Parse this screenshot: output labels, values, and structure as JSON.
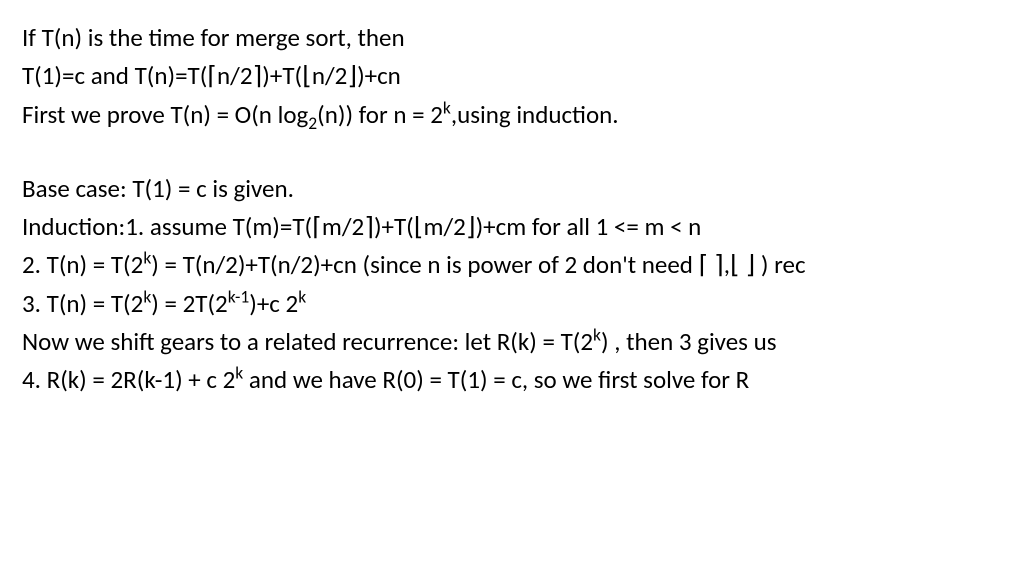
{
  "lines": {
    "l1": "If T(n) is the time for merge sort, then",
    "l2_pre": "T(1)=c and  T(n)=T(",
    "l2_ceil_open": "⌈",
    "l2_ceil_close": "⌉",
    "l2_mid1": "n/2",
    "l2_mid2": ")+T(",
    "l2_floor_open": "⌊",
    "l2_floor_close": "⌋",
    "l2_mid3": "n/2",
    "l2_end": ")+cn",
    "l3_pre": "First we prove T(n) = O(n log",
    "l3_sub": "2",
    "l3_mid": "(n)) for n = 2",
    "l3_sup": "k",
    "l3_end": ",using induction.",
    "l4": "Base case: T(1) = c is given.",
    "l5_pre": "Induction:1.  assume T(m)=T(",
    "l5_ceil_open": "⌈",
    "l5_mid1": "m/2",
    "l5_ceil_close": "⌉",
    "l5_mid2": ")+T(",
    "l5_floor_open": "⌊",
    "l5_mid3": "m/2",
    "l5_floor_close": "⌋",
    "l5_end": ")+cm for  all 1 <= m < n",
    "l6_pre": "2. T(n) = T(2",
    "l6_sup1": "k",
    "l6_mid": ") = T(n/2)+T(n/2)+cn  (since n is power of 2 don't need ",
    "l6_ceil_open": "⌈",
    "l6_space": " ",
    "l6_ceil_close": "⌉",
    "l6_comma": ",",
    "l6_floor_open": "⌊",
    "l6_floor_close": "⌋",
    "l6_end": " ) rec",
    "l7_pre": "3. T(n) = T(2",
    "l7_sup1": "k",
    "l7_mid1": ") = 2T(2",
    "l7_sup2": "k-1",
    "l7_mid2": ")+c 2",
    "l7_sup3": "k",
    "l8_pre": "Now we shift gears to a related recurrence: let R(k) = T(2",
    "l8_sup": "k",
    "l8_end": ") , then 3 gives us",
    "l9_pre": "4. R(k) = 2R(k-1) + c 2",
    "l9_sup": "k",
    "l9_end": " and we have R(0) = T(1) = c, so we first solve for R"
  }
}
